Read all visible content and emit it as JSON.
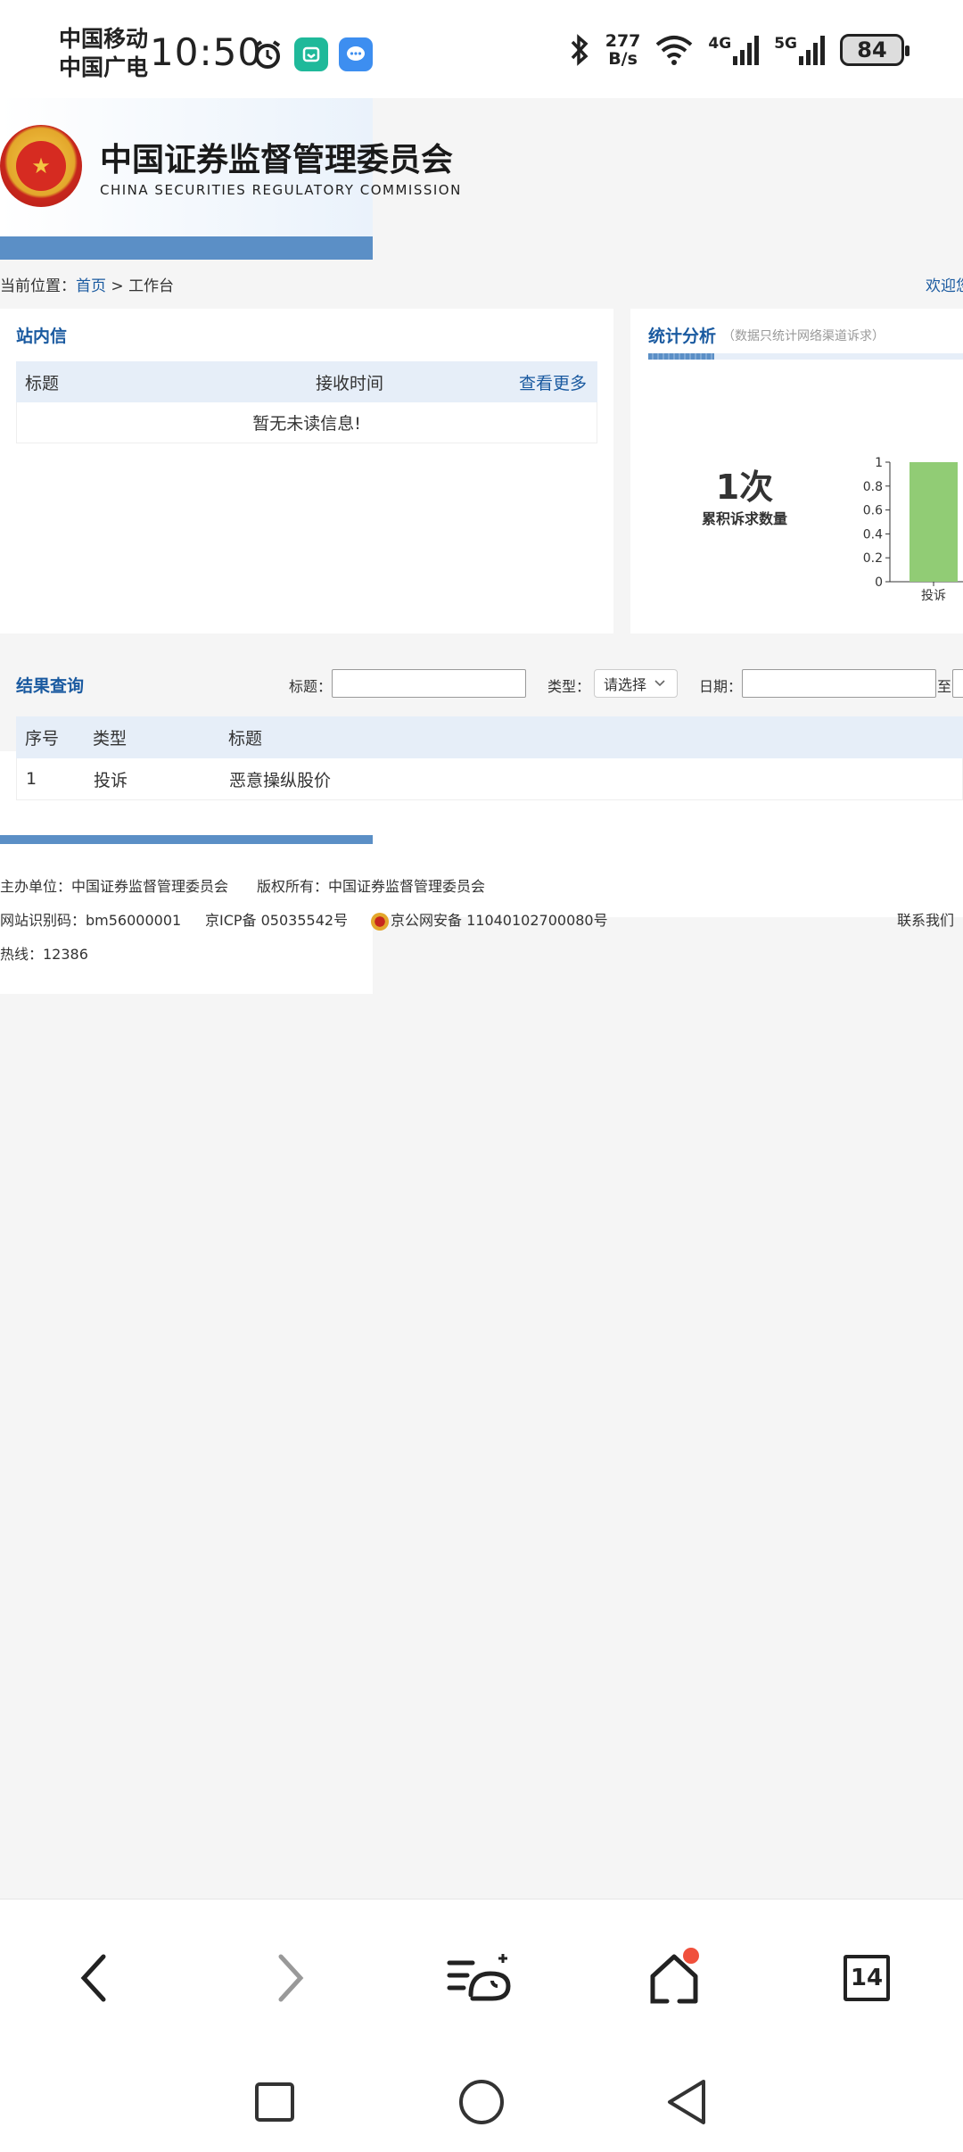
{
  "status_bar": {
    "carrier_1": "中国移动",
    "carrier_2": "中国广电",
    "time": "10:50",
    "net_speed_value": "277",
    "net_speed_unit": "B/s",
    "signal_1": "4G",
    "signal_2": "5G",
    "battery": "84",
    "icons": [
      "alarm-icon",
      "mi-app-icon",
      "message-app-icon",
      "bluetooth-icon",
      "wifi-icon",
      "signal-icon"
    ]
  },
  "header": {
    "org_name_cn": "中国证券监督管理委员会",
    "org_name_en": "CHINA SECURITIES REGULATORY COMMISSION"
  },
  "breadcrumb": {
    "prefix": "当前位置：",
    "home": "首页",
    "separator": " > ",
    "current": "工作台",
    "welcome": "欢迎您"
  },
  "mailbox": {
    "title": "站内信",
    "col_title": "标题",
    "col_time": "接收时间",
    "more": "查看更多",
    "empty_message": "暂无未读信息!"
  },
  "stats": {
    "title": "统计分析",
    "subtitle": "（数据只统计网络渠道诉求）",
    "count": "1次",
    "count_label": "累积诉求数量"
  },
  "chart_data": {
    "type": "bar",
    "categories": [
      "投诉"
    ],
    "values": [
      1
    ],
    "ylim": [
      0,
      1
    ],
    "yticks": [
      "0",
      "0.2",
      "0.4",
      "0.6",
      "0.8",
      "1"
    ],
    "bar_color": "#91cc75"
  },
  "results": {
    "title": "结果查询",
    "filter_title_label": "标题：",
    "filter_type_label": "类型：",
    "filter_type_value": "请选择",
    "filter_date_label": "日期：",
    "filter_date_to": "至",
    "columns": [
      "序号",
      "类型",
      "标题"
    ],
    "rows": [
      {
        "no": "1",
        "type": "投诉",
        "title": "恶意操纵股价"
      }
    ]
  },
  "footer": {
    "line1": "主办单位：中国证券监督管理委员会　　版权所有：中国证券监督管理委员会",
    "site_id": "网站识别码：bm56000001",
    "icp": "京ICP备 05035542号",
    "police": "京公网安备 11040102700080号",
    "hotline": "热线：12386",
    "contact": "联系我们"
  },
  "browser_toolbar": {
    "tab_count": "14"
  },
  "colors": {
    "brand_blue": "#1a5aa0",
    "bar_blue": "#5b8fc6",
    "header_bg": "#e6eef8",
    "badge_red": "#f0503c"
  }
}
